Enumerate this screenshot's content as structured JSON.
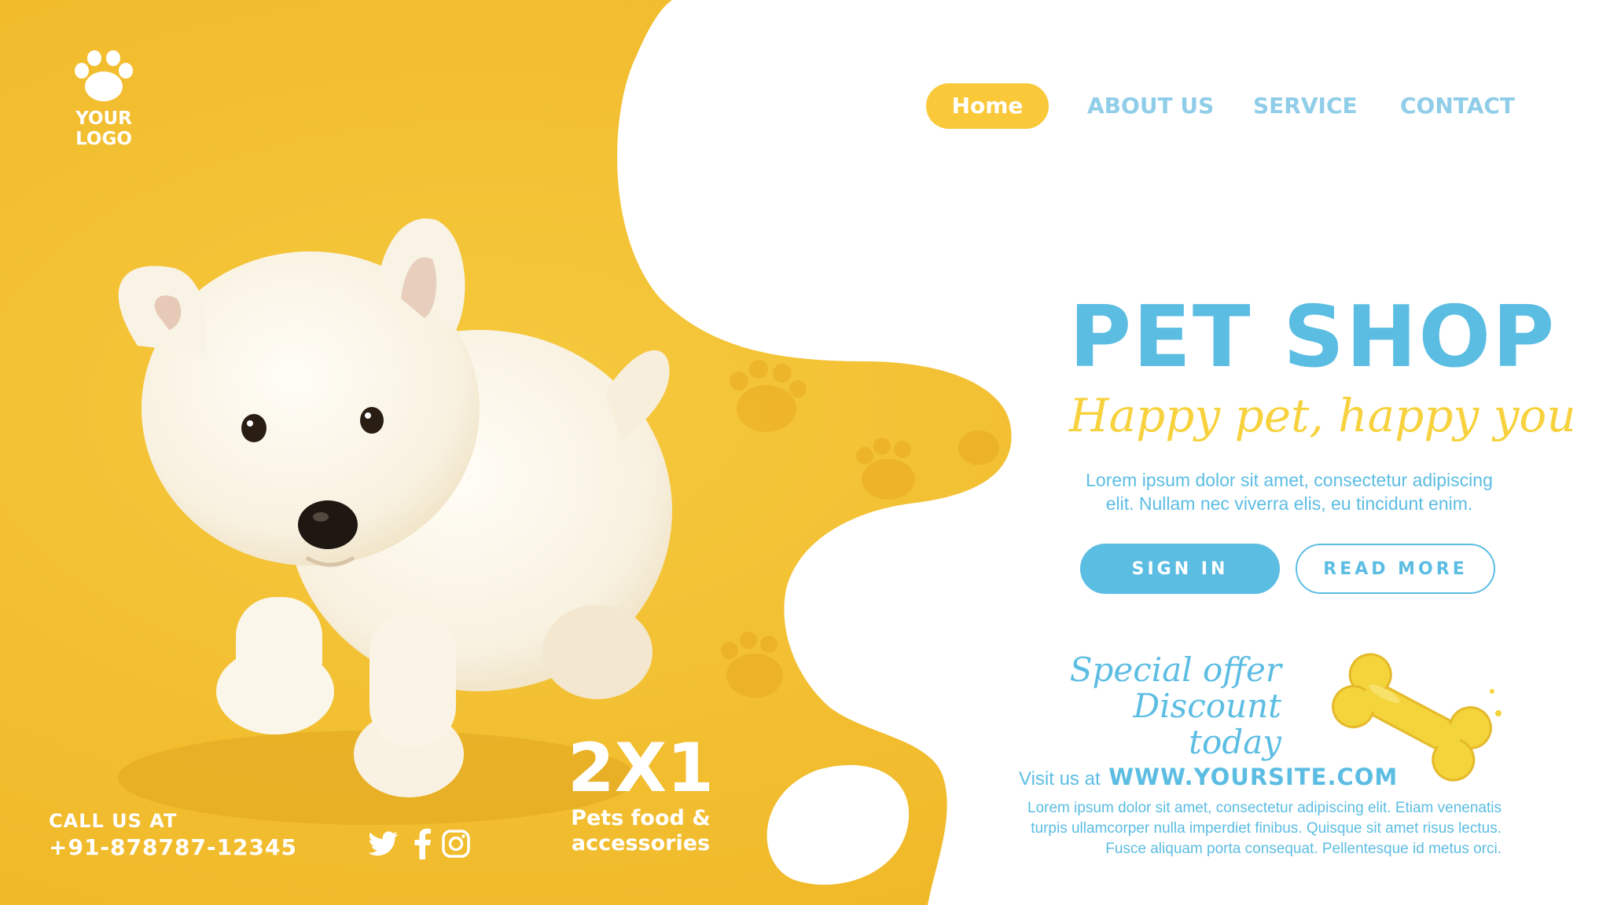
{
  "logo": {
    "text": "YOUR LOGO",
    "icon": "paw-icon"
  },
  "nav": {
    "home": "Home",
    "about": "ABOUT US",
    "service": "SERVICE",
    "contact": "CONTACT"
  },
  "hero": {
    "title": "PET SHOP",
    "subtitle": "Happy pet, happy you",
    "description_line1": "Lorem ipsum dolor sit amet, consectetur adipiscing",
    "description_line2": "elit. Nullam nec viverra elis, eu tincidunt enim."
  },
  "buttons": {
    "sign_in": "SIGN IN",
    "read_more": "READ MORE"
  },
  "offer": {
    "line1": "Special offer",
    "line2": "Discount  today",
    "icon": "bone-icon"
  },
  "visit": {
    "label": "Visit us at",
    "url": "WWW.YOURSITE.COM"
  },
  "footer": {
    "line1": "Lorem ipsum dolor sit amet, consectetur adipiscing elit. Etiam venenatis",
    "line2": "turpis ullamcorper nulla imperdiet finibus. Quisque sit amet risus lectus.",
    "line3": "Fusce aliquam porta consequat. Pellentesque id metus orci."
  },
  "contact": {
    "label": "CALL US AT",
    "number": "+91-878787-12345"
  },
  "socials": [
    "twitter-icon",
    "facebook-icon",
    "instagram-icon"
  ],
  "promo": {
    "big": "2X1",
    "line1": "Pets food &",
    "line2": "accessories"
  },
  "colors": {
    "yellow": "#f1bd2b",
    "blue": "#5cbde3",
    "light_blue": "#8fcde8",
    "white": "#ffffff"
  }
}
